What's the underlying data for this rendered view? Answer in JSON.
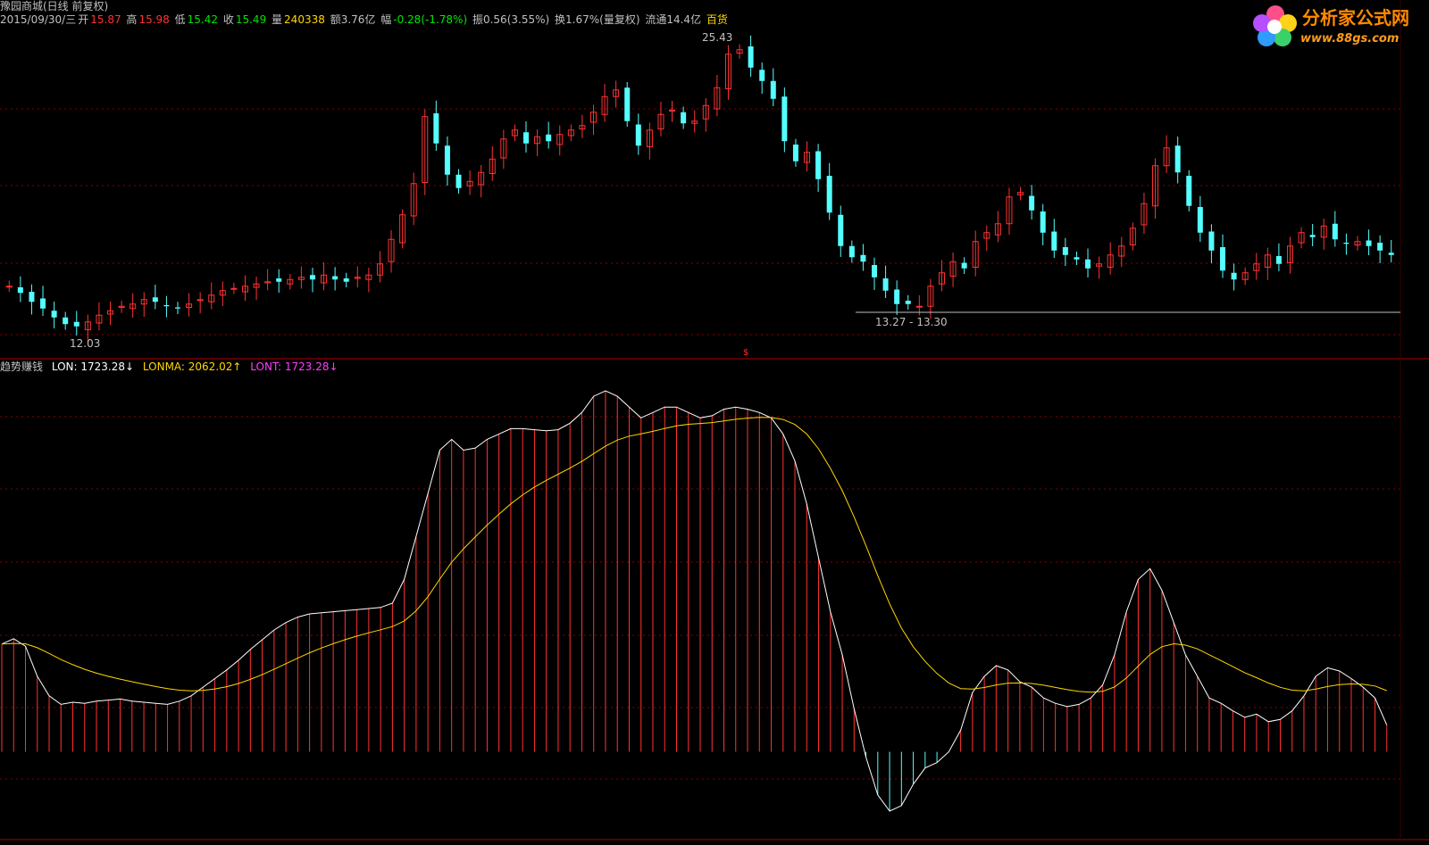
{
  "header": {
    "title": "豫园商城(日线 前复权)",
    "date": "2015/09/30/三",
    "open_label": "开",
    "open": "15.87",
    "high_label": "高",
    "high": "15.98",
    "low_label": "低",
    "low": "15.42",
    "close_label": "收",
    "close": "15.49",
    "vol_label": "量",
    "volume": "240338",
    "amount": "额3.76亿",
    "change_label": "幅",
    "change": "-0.28(-1.78%)",
    "amplitude": "振0.56(3.55%)",
    "turnover": "换1.67%(量复权)",
    "float": "流通14.4亿",
    "sector": "百货"
  },
  "chart_labels": {
    "high_mark": "25.43",
    "low_mark": "12.03",
    "range_mark": "13.27 - 13.30",
    "event_mark": "$"
  },
  "indicator": {
    "name": "趋势赚钱",
    "lon": "LON: 1723.28↓",
    "lonma": "LONMA: 2062.02↑",
    "lont": "LONT: 1723.28↓"
  },
  "colors": {
    "up": "#ff3232",
    "down": "#54ffff",
    "grid": "#8b0000",
    "lonma": "#ffd700",
    "lont": "#ff3cff",
    "lon_line": "#ffffff"
  },
  "logo": {
    "text": "分析家公式网",
    "url": "www.88gs.com"
  },
  "chart_data": {
    "type": "line",
    "price_range": [
      12.03,
      25.43
    ],
    "price_closes": [
      14.2,
      13.9,
      13.5,
      13.2,
      12.8,
      12.5,
      12.4,
      12.6,
      12.9,
      13.1,
      13.3,
      13.4,
      13.6,
      13.5,
      13.3,
      13.2,
      13.4,
      13.6,
      13.8,
      14.0,
      14.1,
      14.2,
      14.3,
      14.4,
      14.4,
      14.5,
      14.6,
      14.5,
      14.7,
      14.5,
      14.4,
      14.6,
      14.7,
      15.2,
      16.3,
      17.4,
      18.8,
      21.8,
      20.6,
      19.2,
      18.6,
      18.9,
      19.3,
      19.9,
      20.8,
      21.2,
      20.6,
      20.9,
      20.7,
      21.0,
      21.2,
      21.4,
      22.0,
      22.7,
      23.0,
      21.6,
      20.5,
      21.2,
      21.9,
      22.1,
      21.5,
      21.6,
      22.3,
      23.1,
      24.6,
      24.8,
      24.0,
      23.4,
      22.6,
      20.7,
      19.8,
      20.2,
      19.0,
      17.5,
      16.0,
      15.5,
      15.3,
      14.6,
      14.0,
      13.4,
      13.4,
      13.3,
      14.2,
      14.8,
      15.3,
      15.0,
      16.2,
      16.6,
      17.0,
      18.2,
      18.4,
      17.6,
      16.6,
      15.8,
      15.6,
      15.4,
      15.0,
      15.2,
      15.6,
      16.0,
      16.8,
      17.9,
      19.6,
      20.4,
      19.3,
      17.8,
      16.6,
      15.8,
      14.9,
      14.5,
      14.8,
      15.2,
      15.6,
      15.2,
      16.0,
      16.6,
      16.4,
      16.9,
      16.3,
      16.1,
      16.2,
      16.0,
      15.8,
      15.6
    ],
    "lon_values": [
      1000,
      1050,
      980,
      700,
      520,
      440,
      460,
      450,
      470,
      480,
      490,
      470,
      460,
      450,
      440,
      470,
      520,
      600,
      680,
      760,
      850,
      950,
      1040,
      1130,
      1200,
      1250,
      1280,
      1290,
      1300,
      1310,
      1320,
      1330,
      1340,
      1380,
      1600,
      2000,
      2400,
      2800,
      2900,
      2800,
      2820,
      2900,
      2950,
      3000,
      3000,
      2990,
      2980,
      2990,
      3050,
      3150,
      3300,
      3350,
      3300,
      3200,
      3100,
      3150,
      3200,
      3200,
      3150,
      3100,
      3120,
      3180,
      3200,
      3180,
      3150,
      3100,
      2950,
      2700,
      2300,
      1800,
      1300,
      900,
      400,
      -50,
      -400,
      -550,
      -500,
      -300,
      -150,
      -100,
      0,
      200,
      550,
      700,
      800,
      760,
      650,
      600,
      500,
      450,
      420,
      440,
      500,
      620,
      900,
      1300,
      1600,
      1700,
      1500,
      1200,
      900,
      700,
      500,
      450,
      380,
      320,
      350,
      280,
      300,
      380,
      520,
      700,
      780,
      750,
      680,
      600,
      500,
      250
    ]
  }
}
